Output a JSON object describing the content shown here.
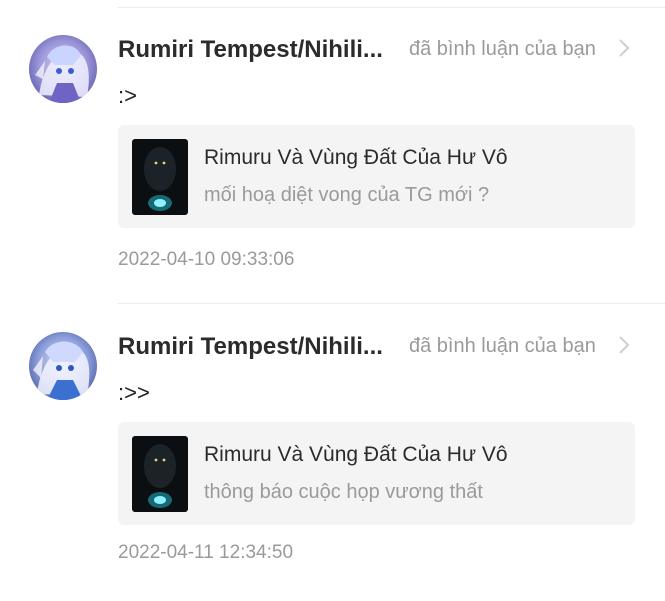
{
  "notifications": [
    {
      "user": "Rumiri Tempest/Nihili...",
      "action": "đã bình luận của bạn",
      "comment": ":>",
      "story_title": "Rimuru Và Vùng Đất Của Hư Vô",
      "comment_subject": "mối hoạ diệt vong của TG mới ?",
      "timestamp": "2022-04-10 09:33:06"
    },
    {
      "user": "Rumiri Tempest/Nihili...",
      "action": "đã bình luận của bạn",
      "comment": ":>>",
      "story_title": "Rimuru Và Vùng Đất Của Hư Vô",
      "comment_subject": "thông báo cuộc họp vương thất",
      "timestamp": "2022-04-11 12:34:50"
    }
  ],
  "colors": {
    "muted_text": "#9a9a9a",
    "card_background": "#f4f4f4",
    "divider": "#ececec"
  },
  "icons": {
    "avatar": "anime-avatar-icon",
    "chevron": "chevron-right-icon",
    "thumbnail": "story-cover-thumbnail"
  }
}
